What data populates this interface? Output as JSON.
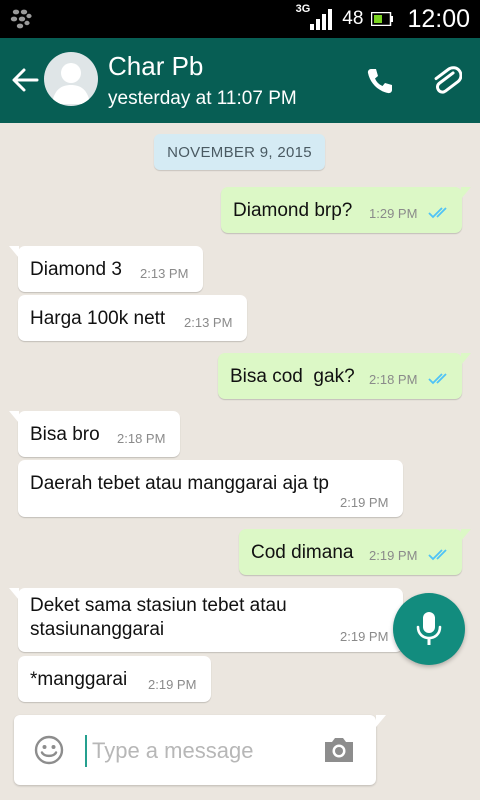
{
  "status_bar": {
    "network": "3G",
    "battery": "48",
    "time": "12:00"
  },
  "header": {
    "contact_name": "Char Pb",
    "last_seen": "yesterday at 11:07 PM"
  },
  "chat": {
    "date_chip": "NOVEMBER 9, 2015",
    "messages": [
      {
        "direction": "out",
        "text": "Diamond brp?",
        "time": "1:29 PM",
        "status": "read"
      },
      {
        "direction": "in",
        "text": "Diamond 3",
        "time": "2:13 PM"
      },
      {
        "direction": "in",
        "text": "Harga 100k nett",
        "time": "2:13 PM"
      },
      {
        "direction": "out",
        "text": "Bisa cod  gak?",
        "time": "2:18 PM",
        "status": "read"
      },
      {
        "direction": "in",
        "text": "Bisa bro",
        "time": "2:18 PM"
      },
      {
        "direction": "in",
        "text": "Daerah tebet atau manggarai aja tp",
        "time": "2:19 PM"
      },
      {
        "direction": "out",
        "text": "Cod dimana",
        "time": "2:19 PM",
        "status": "read"
      },
      {
        "direction": "in",
        "lines": [
          "Deket sama stasiun tebet atau",
          "stasiunanggarai"
        ],
        "time": "2:19 PM"
      },
      {
        "direction": "in",
        "text": "*manggarai",
        "time": "2:19 PM"
      }
    ]
  },
  "composer": {
    "placeholder": "Type a message"
  },
  "icons": {
    "back": "arrow-left-icon",
    "avatar": "default-avatar-icon",
    "call": "phone-icon",
    "attach": "paperclip-icon",
    "emoji": "smiley-icon",
    "camera": "camera-icon",
    "mic": "microphone-icon",
    "read_receipt": "double-check-icon"
  },
  "colors": {
    "app_bar": "#075e54",
    "chat_background": "#ebe6df",
    "outgoing_bubble": "#dcf8c6",
    "incoming_bubble": "#ffffff",
    "date_chip": "#d5ebf4",
    "fab": "#128c7e",
    "read_ticks": "#4fc3f7"
  }
}
